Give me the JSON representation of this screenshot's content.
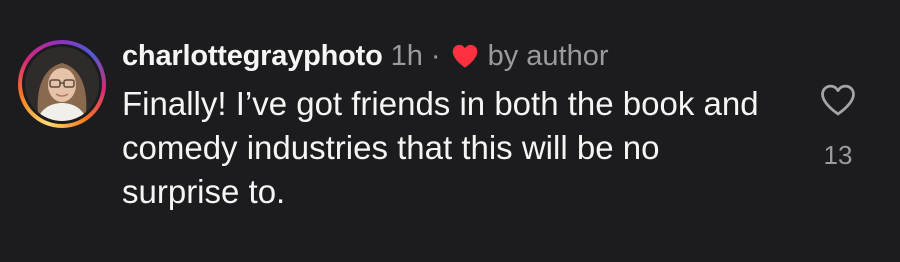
{
  "comment": {
    "username": "charlottegrayphoto",
    "time": "1h",
    "separator": "·",
    "author_badge_icon": "red-heart-icon",
    "author_badge_text": "by author",
    "text": "Finally! I’ve got friends in both the book and comedy industries that this will be no surprise to.",
    "like_icon": "heart-outline-icon",
    "like_count": "13"
  },
  "colors": {
    "background": "#1c1c1e",
    "primary_text": "#f5f5f5",
    "secondary_text": "#9a9a9f",
    "heart_red": "#ff3040"
  }
}
